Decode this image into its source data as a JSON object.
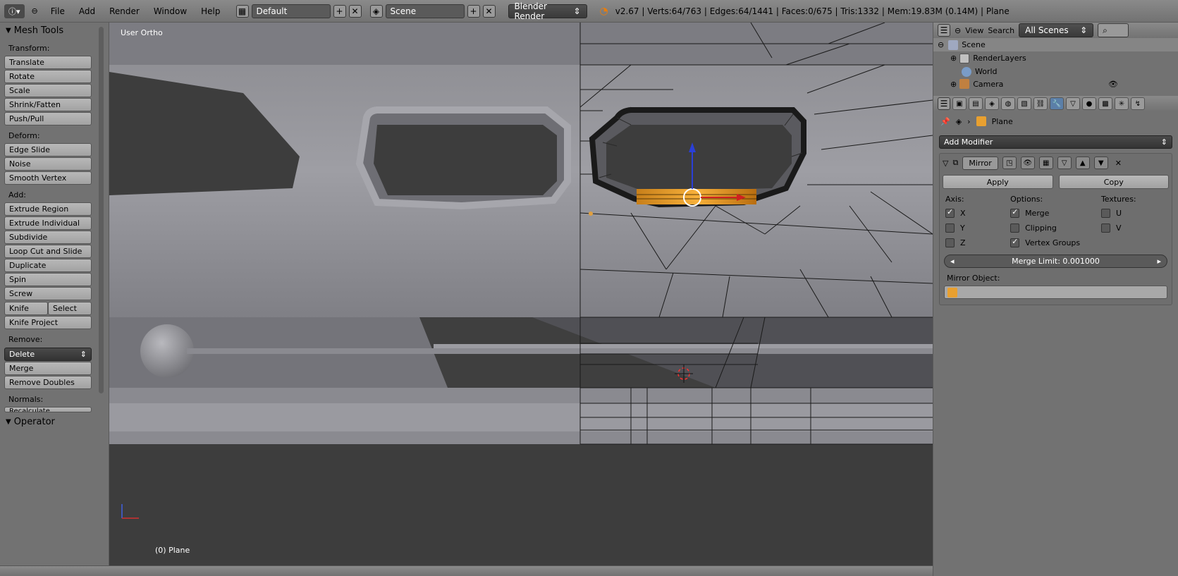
{
  "topbar": {
    "menus": [
      "File",
      "Add",
      "Render",
      "Window",
      "Help"
    ],
    "layout_name": "Default",
    "scene_name": "Scene",
    "render_engine": "Blender Render",
    "info": "v2.67 | Verts:64/763 | Edges:64/1441 | Faces:0/675 | Tris:1332 | Mem:19.83M (0.14M) | Plane"
  },
  "toolshelf": {
    "title": "Mesh Tools",
    "transform_label": "Transform:",
    "transform": [
      "Translate",
      "Rotate",
      "Scale",
      "Shrink/Fatten",
      "Push/Pull"
    ],
    "deform_label": "Deform:",
    "deform": [
      "Edge Slide",
      "Noise",
      "Smooth Vertex"
    ],
    "add_label": "Add:",
    "add": [
      "Extrude Region",
      "Extrude Individual",
      "Subdivide",
      "Loop Cut and Slide",
      "Duplicate",
      "Spin",
      "Screw"
    ],
    "knife": "Knife",
    "select": "Select",
    "knife_project": "Knife Project",
    "remove_label": "Remove:",
    "delete": "Delete",
    "remove": [
      "Merge",
      "Remove Doubles"
    ],
    "normals_label": "Normals:",
    "recalculate": "Recalculate",
    "operator": "Operator"
  },
  "viewport": {
    "view_label": "User Ortho",
    "object_label": "(0) Plane"
  },
  "outliner": {
    "view": "View",
    "search": "Search",
    "filter": "All Scenes",
    "items": [
      "Scene",
      "RenderLayers",
      "World",
      "Camera"
    ]
  },
  "properties": {
    "context": "Plane",
    "add_modifier": "Add Modifier",
    "modifier_name": "Mirror",
    "apply": "Apply",
    "copy": "Copy",
    "axis_label": "Axis:",
    "axes": [
      {
        "label": "X",
        "checked": true
      },
      {
        "label": "Y",
        "checked": false
      },
      {
        "label": "Z",
        "checked": false
      }
    ],
    "options_label": "Options:",
    "options": [
      {
        "label": "Merge",
        "checked": true
      },
      {
        "label": "Clipping",
        "checked": false
      },
      {
        "label": "Vertex Groups",
        "checked": true
      }
    ],
    "textures_label": "Textures:",
    "textures": [
      {
        "label": "U",
        "checked": false
      },
      {
        "label": "V",
        "checked": false
      }
    ],
    "merge_limit": "Merge Limit: 0.001000",
    "mirror_object_label": "Mirror Object:"
  },
  "colors": {
    "accent_blue": "#5b7fa8",
    "selection_orange": "#f5a623",
    "viewport_bg": "#3d3d3d"
  }
}
